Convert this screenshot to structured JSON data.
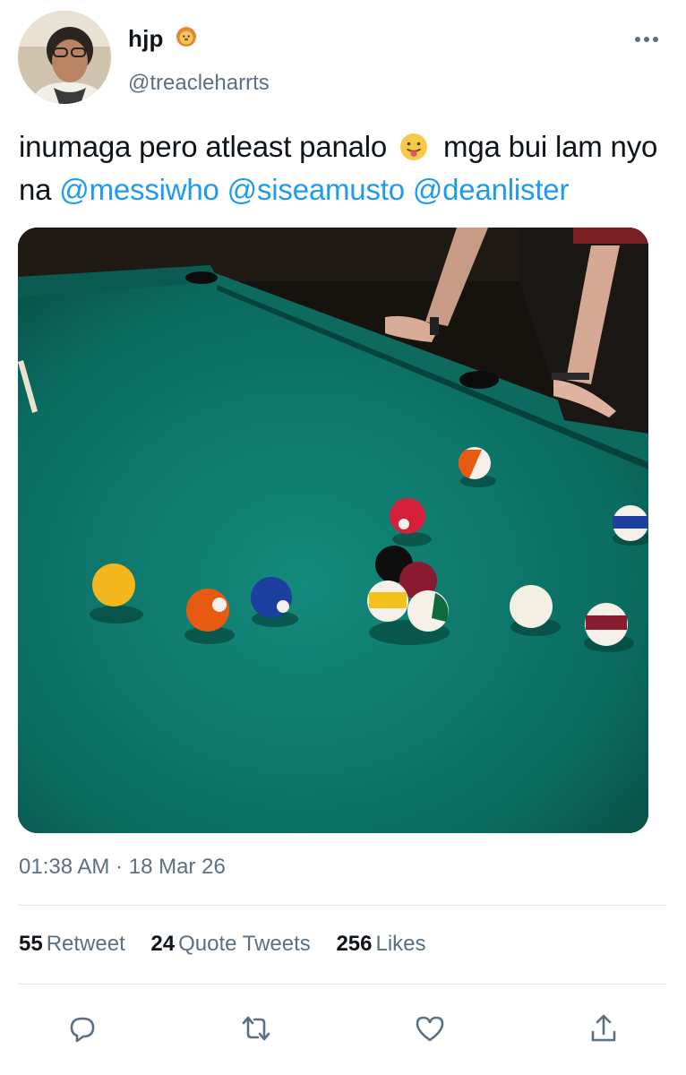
{
  "author": {
    "display_name": "hjp",
    "badge_icon": "lion-emoji",
    "handle": "@treacleharrts"
  },
  "tweet": {
    "text_part1": "inumaga pero atleast panalo",
    "emoji": "tongue-out-emoji",
    "text_part2": "mga bui lam nyo na",
    "mentions": [
      "@messiwho",
      "@siseamusto",
      "@deanlister"
    ],
    "timestamp": "01:38 AM · 18 Mar 26"
  },
  "stats": [
    {
      "count": "55",
      "label": "Retweet"
    },
    {
      "count": "24",
      "label": "Quote Tweets"
    },
    {
      "count": "256",
      "label": "Likes"
    }
  ],
  "actions": [
    "reply-icon",
    "retweet-icon",
    "like-icon",
    "share-icon"
  ],
  "colors": {
    "link": "#1d9bf0",
    "secondary": "#5b7083",
    "divider": "#e1e8ed",
    "felt": "#0c7a6e"
  }
}
